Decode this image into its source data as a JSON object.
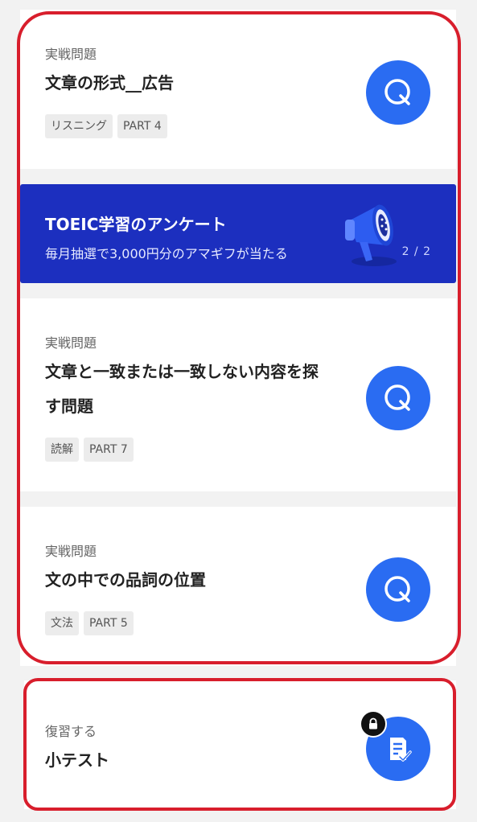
{
  "cards": [
    {
      "label": "実戦問題",
      "title": "文章の形式__広告",
      "tags": [
        "リスニング",
        "PART 4"
      ],
      "icon": "quiz-icon"
    },
    {
      "label": "実戦問題",
      "title_line1": "文章と一致または一致しない内容を探",
      "title_line2": "す問題",
      "tags": [
        "読解",
        "PART 7"
      ],
      "icon": "quiz-icon"
    },
    {
      "label": "実戦問題",
      "title": "文の中での品詞の位置",
      "tags": [
        "文法",
        "PART 5"
      ],
      "icon": "quiz-icon"
    }
  ],
  "banner": {
    "title": "TOEIC学習のアンケート",
    "subtitle": "毎月抽選で3,000円分のアマギフが当たる",
    "page": "2 / 2",
    "icon": "megaphone-icon",
    "color": "#1c2fbf"
  },
  "review": {
    "label": "復習する",
    "title": "小テスト",
    "icon": "document-check-icon",
    "lock_icon": "lock-icon"
  },
  "colors": {
    "accent": "#2a6cf2",
    "highlight_outline": "#d81e2c"
  }
}
